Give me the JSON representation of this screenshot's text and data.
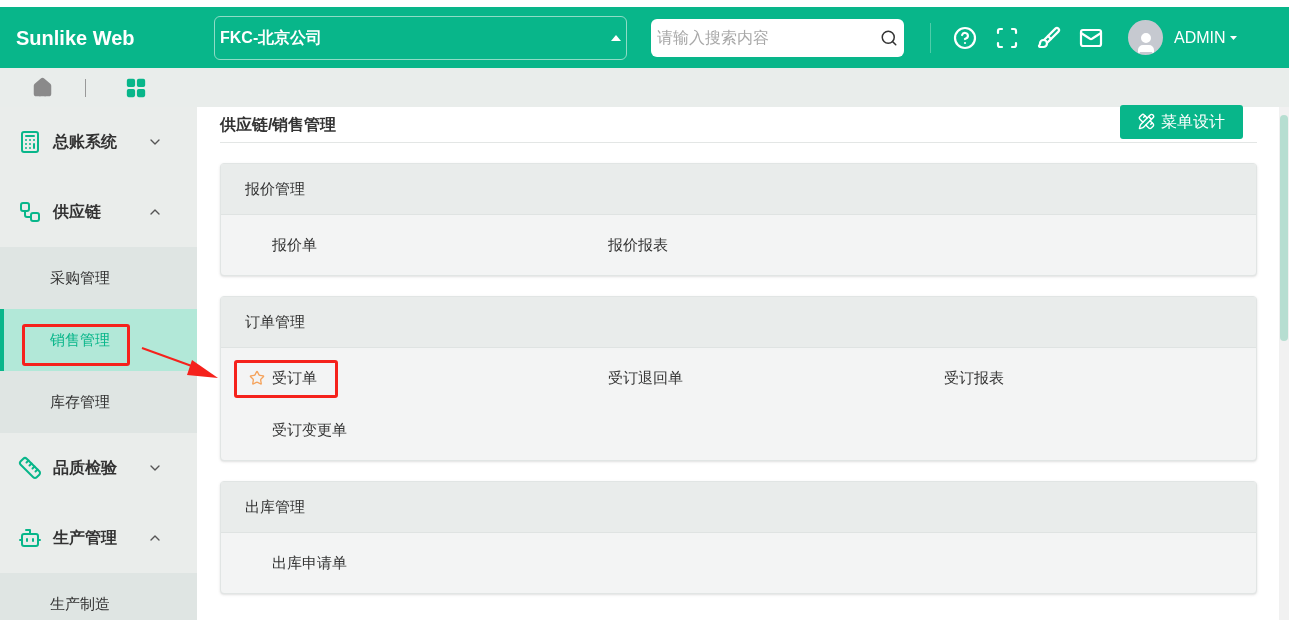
{
  "header": {
    "logo": "Sunlike Web",
    "company": "FKC-北京公司",
    "search": {
      "placeholder": "请输入搜索内容"
    },
    "user": "ADMIN"
  },
  "sidebar": {
    "items": [
      {
        "label": "总账系统",
        "expanded": false
      },
      {
        "label": "供应链",
        "expanded": true,
        "children": [
          {
            "label": "采购管理",
            "selected": false,
            "annotated": false
          },
          {
            "label": "销售管理",
            "selected": true,
            "annotated": true
          },
          {
            "label": "库存管理",
            "selected": false,
            "annotated": false
          }
        ]
      },
      {
        "label": "品质检验",
        "expanded": false
      },
      {
        "label": "生产管理",
        "expanded": true,
        "children": [
          {
            "label": "生产制造",
            "selected": false,
            "annotated": false
          }
        ]
      }
    ]
  },
  "breadcrumb": "供应链/销售管理",
  "design_button": "菜单设计",
  "sections": [
    {
      "title": "报价管理",
      "items": [
        {
          "label": "报价单",
          "starred": false,
          "annotated": false
        },
        {
          "label": "报价报表",
          "starred": false,
          "annotated": false
        }
      ]
    },
    {
      "title": "订单管理",
      "items": [
        {
          "label": "受订单",
          "starred": true,
          "annotated": true
        },
        {
          "label": "受订退回单",
          "starred": false,
          "annotated": false
        },
        {
          "label": "受订报表",
          "starred": false,
          "annotated": false
        },
        {
          "label": "受订变更单",
          "starred": false,
          "annotated": false
        }
      ]
    },
    {
      "title": "出库管理",
      "items": [
        {
          "label": "出库申请单",
          "starred": false,
          "annotated": false
        }
      ]
    }
  ]
}
